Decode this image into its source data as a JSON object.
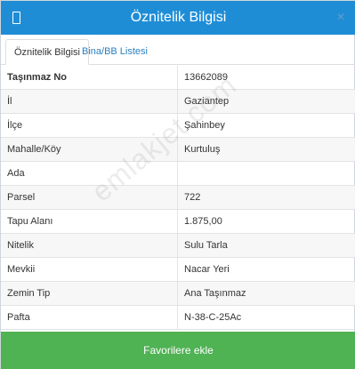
{
  "header": {
    "title": "Öznitelik Bilgisi",
    "close_label": "×",
    "left_icon": "document-icon"
  },
  "tabs": [
    {
      "label": "Öznitelik Bilgisi",
      "active": true
    },
    {
      "label": "Bina/BB Listesi",
      "active": false
    }
  ],
  "table": {
    "rows": [
      {
        "label": "Taşınmaz No",
        "value": "13662089"
      },
      {
        "label": "İl",
        "value": "Gaziantep"
      },
      {
        "label": "İlçe",
        "value": "Şahinbey"
      },
      {
        "label": "Mahalle/Köy",
        "value": "Kurtuluş"
      },
      {
        "label": "Ada",
        "value": ""
      },
      {
        "label": "Parsel",
        "value": "722"
      },
      {
        "label": "Tapu Alanı",
        "value": "1.875,00"
      },
      {
        "label": "Nitelik",
        "value": "Sulu Tarla"
      },
      {
        "label": "Mevkii",
        "value": "Nacar Yeri"
      },
      {
        "label": "Zemin Tip",
        "value": "Ana Taşınmaz"
      },
      {
        "label": "Pafta",
        "value": "N-38-C-25Ac"
      }
    ]
  },
  "watermark": "emlakjet.com",
  "footer": {
    "favorite_label": "Favorilere ekle"
  },
  "colors": {
    "header": "#1f8dd6",
    "footer": "#4fb253"
  }
}
